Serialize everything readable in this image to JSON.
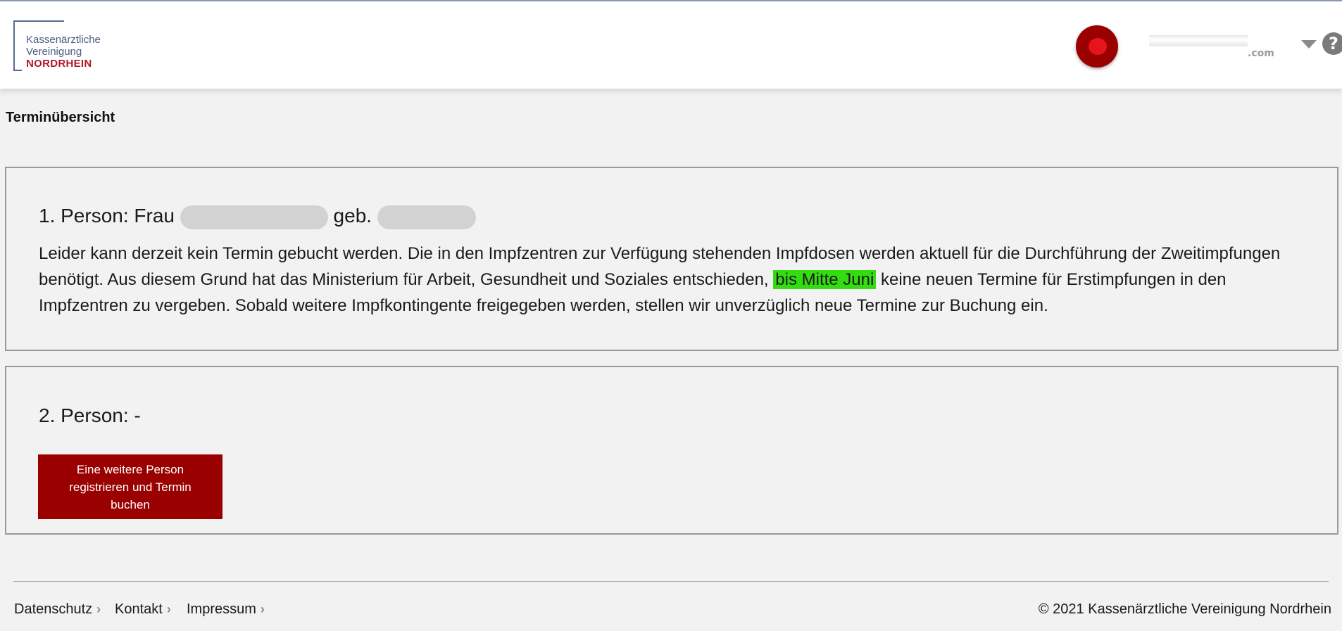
{
  "header": {
    "logo": {
      "line1": "Kassenärztliche",
      "line2": "Vereinigung",
      "line3": "NORDRHEIN"
    },
    "user": {
      "email_suffix": ".com"
    },
    "help_symbol": "?"
  },
  "page": {
    "title": "Terminübersicht"
  },
  "person1": {
    "heading_prefix": "1. Person: Frau",
    "heading_geb": "geb.",
    "text_before": "Leider kann derzeit kein Termin gebucht werden. Die in den Impfzentren zur Verfügung stehenden Impfdosen werden aktuell für die Durchführung der Zweitimpfungen benötigt. Aus diesem Grund hat das Ministerium für Arbeit, Gesundheit und Soziales entschieden,",
    "text_highlight": "bis Mitte Juni",
    "text_after": "keine neuen Termine für Erstimpfungen in den Impfzentren zu vergeben. Sobald weitere Impfkontingente freigegeben werden, stellen wir unverzüglich neue Termine zur Buchung ein.",
    "highlight_color": "#33dd11"
  },
  "person2": {
    "heading": "2. Person: -",
    "button_label": "Eine weitere Person registrieren und Termin buchen"
  },
  "footer": {
    "links": [
      "Datenschutz",
      "Kontakt",
      "Impressum"
    ],
    "copyright": "© 2021 Kassenärztliche Vereinigung Nordrhein"
  },
  "colors": {
    "brand_red": "#9a0000",
    "logo_blue": "#4a5d80",
    "logo_red": "#b0182a"
  },
  "icons": {
    "dropdown": "chevron-down-icon",
    "help": "help-icon",
    "footer_chevron": "chevron-right-icon"
  }
}
